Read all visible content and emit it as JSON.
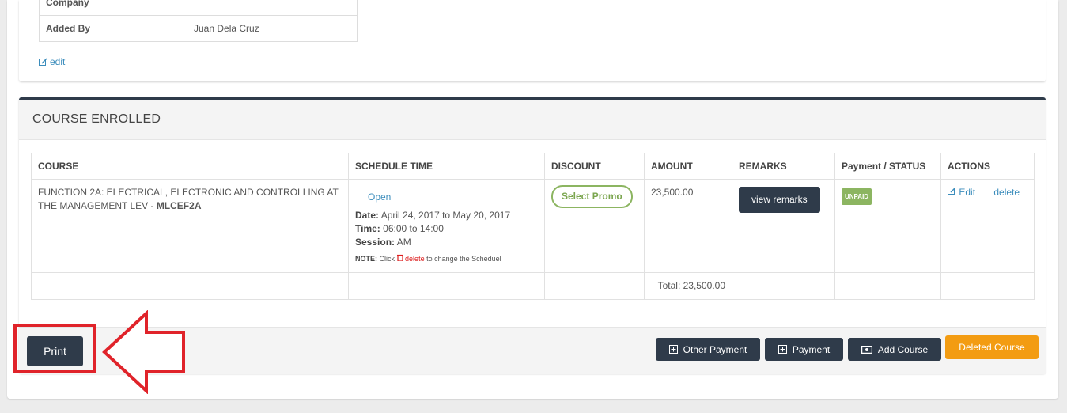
{
  "info": {
    "partial_label": "Company",
    "added_by_label": "Added By",
    "added_by_value": "Juan Dela Cruz",
    "edit_label": "edit"
  },
  "course_panel": {
    "title": "COURSE ENROLLED",
    "columns": [
      "COURSE",
      "SCHEDULE TIME",
      "DISCOUNT",
      "AMOUNT",
      "REMARKS",
      "Payment / STATUS",
      "ACTIONS"
    ],
    "row": {
      "course_name": "FUNCTION 2A: ELECTRICAL, ELECTRONIC AND CONTROLLING AT THE MANAGEMENT LEV - ",
      "course_code": "MLCEF2A",
      "schedule_status": "Open",
      "date_label": "Date:",
      "date_value": "April 24, 2017 to May 20, 2017",
      "time_label": "Time:",
      "time_value": "06:00 to 14:00",
      "session_label": "Session:",
      "session_value": "AM",
      "note_label": "NOTE:",
      "note_pre": "Click",
      "note_delete": "delete",
      "note_post": "to change the Scheduel",
      "discount_button": "Select Promo",
      "amount": "23,500.00",
      "remarks_button": "view remarks",
      "status_badge": "UNPAID",
      "edit_action": "Edit",
      "delete_action": "delete"
    },
    "total": "Total: 23,500.00"
  },
  "footer": {
    "print_label": "Print",
    "other_payment_label": "Other Payment",
    "payment_label": "Payment",
    "add_course_label": "Add Course",
    "deleted_course_label": "Deleted Course"
  },
  "colors": {
    "dark_button": "#2f3b4a",
    "promo_green": "#8cb561",
    "orange": "#f39c12",
    "highlight_red": "#e0232a",
    "link_blue": "#3c8dbc"
  }
}
